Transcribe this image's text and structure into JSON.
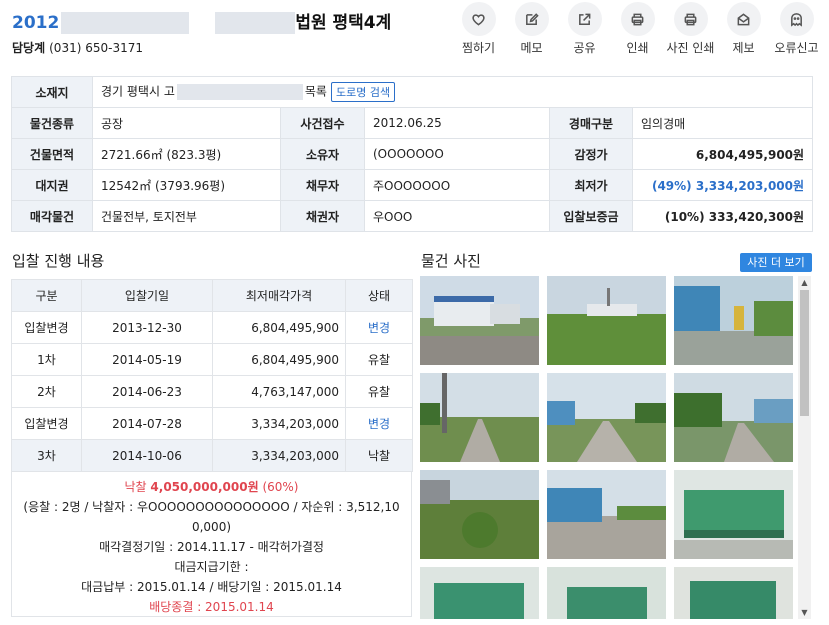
{
  "header": {
    "case_prefix": "2012",
    "court_suffix": "법원 평택4계",
    "contact_label": "담당계",
    "contact_phone": "(031) 650-3171"
  },
  "actions": [
    {
      "label": "찜하기",
      "icon": "heart-icon"
    },
    {
      "label": "메모",
      "icon": "memo-icon"
    },
    {
      "label": "공유",
      "icon": "share-icon"
    },
    {
      "label": "인쇄",
      "icon": "print-icon"
    },
    {
      "label": "사진 인쇄",
      "icon": "photo-print-icon"
    },
    {
      "label": "제보",
      "icon": "report-mail-icon"
    },
    {
      "label": "오류신고",
      "icon": "error-report-icon"
    }
  ],
  "info": {
    "location_label": "소재지",
    "location_prefix": "경기 평택시 고",
    "location_suffix": "목록",
    "road_search": "도로명 검색",
    "rows": [
      {
        "k1": "물건종류",
        "v1": "공장",
        "k2": "사건접수",
        "v2": "2012.06.25",
        "k3": "경매구분",
        "v3": "임의경매"
      },
      {
        "k1": "건물면적",
        "v1": "2721.66㎡ (823.3평)",
        "k2": "소유자",
        "v2": "(OOOOOOO",
        "k3": "감정가",
        "v3": "6,804,495,900원"
      },
      {
        "k1": "대지권",
        "v1": "12542㎡ (3793.96평)",
        "k2": "채무자",
        "v2": "주OOOOOOO",
        "k3": "최저가",
        "v3": "(49%) 3,334,203,000원"
      },
      {
        "k1": "매각물건",
        "v1": "건물전부, 토지전부",
        "k2": "채권자",
        "v2": "우OOO",
        "k3": "입찰보증금",
        "v3": "(10%) 333,420,300원"
      }
    ]
  },
  "bid_section": {
    "title": "입찰 진행 내용",
    "headers": [
      "구분",
      "입찰기일",
      "최저매각가격",
      "상태"
    ],
    "rows": [
      {
        "round": "입찰변경",
        "date": "2013-12-30",
        "price": "6,804,495,900",
        "status": "변경"
      },
      {
        "round": "1차",
        "date": "2014-05-19",
        "price": "6,804,495,900",
        "status": "유찰"
      },
      {
        "round": "2차",
        "date": "2014-06-23",
        "price": "4,763,147,000",
        "status": "유찰"
      },
      {
        "round": "입찰변경",
        "date": "2014-07-28",
        "price": "3,334,203,000",
        "status": "변경"
      },
      {
        "round": "3차",
        "date": "2014-10-06",
        "price": "3,334,203,000",
        "status": "낙찰"
      }
    ],
    "summary": {
      "award_label": "낙찰",
      "award_price": "4,050,000,000원",
      "award_pct": "(60%)",
      "bidders_line": "(응찰 : 2명 / 낙찰자 : 우OOOOOOOOOOOOOOO / 자순위 : 3,512,10",
      "bidders_line2": "0,000)",
      "decision": "매각결정기일 : 2014.11.17 - 매각허가결정",
      "deadline": "대금지급기한 :",
      "payment": "대금납부 : 2015.01.14 / 배당기일 : 2015.01.14",
      "dividend_end": "배당종결 : 2015.01.14"
    }
  },
  "photo_section": {
    "title": "물건 사진",
    "more_button": "사진 더 보기"
  },
  "colors": {
    "accent_blue": "#2b6fc9",
    "button_blue": "#2f86e0",
    "award_red": "#e0454f",
    "header_bg": "#eef2f7"
  }
}
